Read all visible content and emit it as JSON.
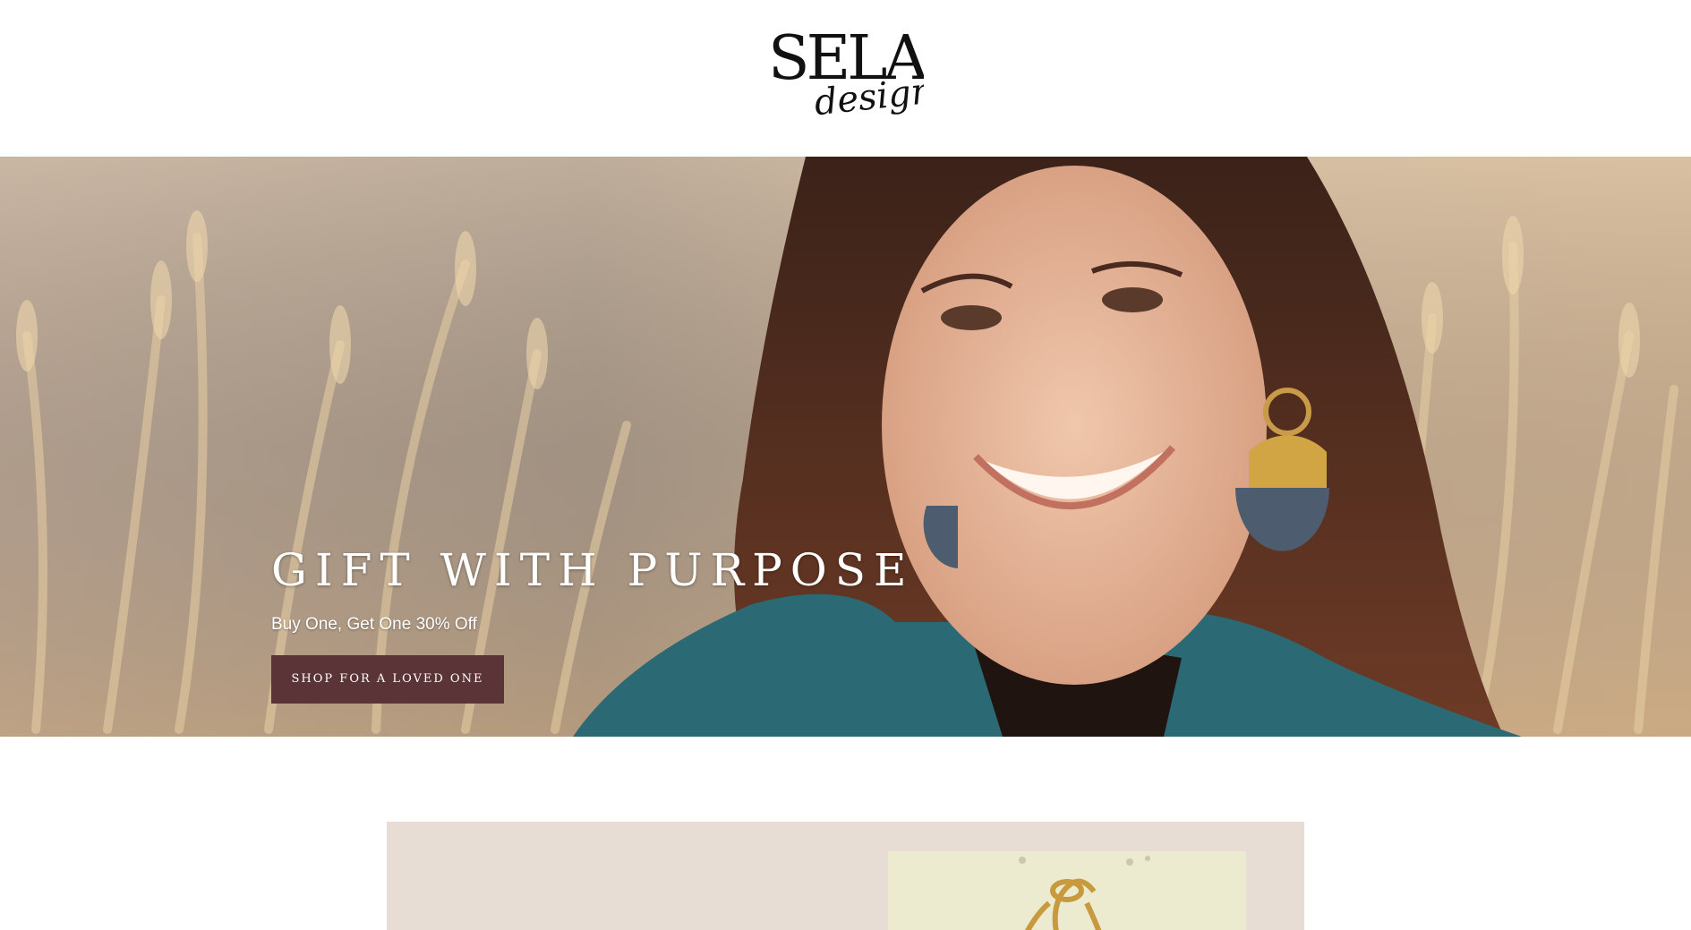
{
  "header": {
    "logo_text_main": "SELA",
    "logo_text_script": "designs",
    "logo_icon": "sela-designs-logo"
  },
  "hero": {
    "title": "GIFT WITH PURPOSE",
    "subtitle": "Buy One, Get One 30% Off",
    "cta_label": "SHOP FOR A LOVED ONE",
    "image": "woman-smiling-in-wheat-field-photo"
  },
  "promo": {
    "image": "gold-chain-bracelet-photo"
  },
  "colors": {
    "cta_background": "#5a3436",
    "promo_panel": "#e7ddd4",
    "header_background": "#ffffff"
  }
}
